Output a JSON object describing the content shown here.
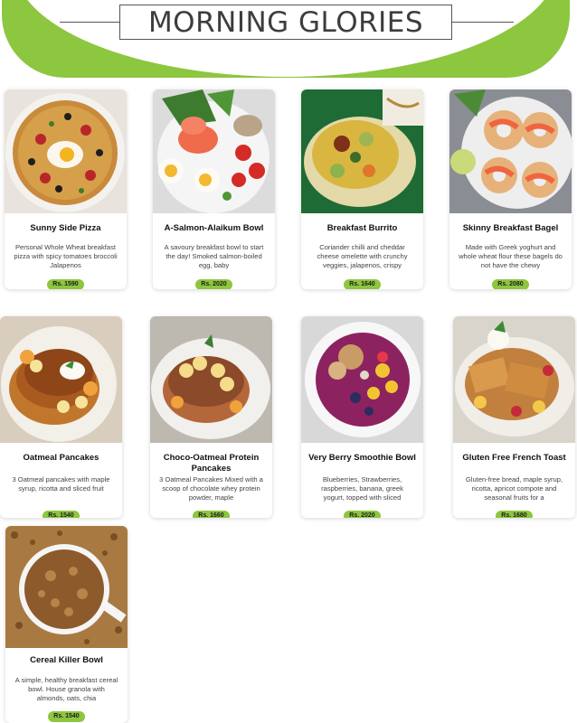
{
  "header": {
    "title": "MORNING GLORIES"
  },
  "colors": {
    "accent": "#8dc63f",
    "title": "#3d3d3d",
    "card_shadow": "#d9d9d9"
  },
  "items": [
    {
      "name": "Sunny Side Pizza",
      "description": "Personal Whole Wheat breakfast pizza with spicy tomatoes broccoli Jalapenos",
      "price": "Rs. 1590"
    },
    {
      "name": "A-Salmon-Alaikum Bowl",
      "description": "A savoury breakfast bowl to start the day! Smoked salmon-boiled egg, baby",
      "price": "Rs. 2020"
    },
    {
      "name": "Breakfast Burrito",
      "description": "Coriander chilli and cheddar cheese omelette with crunchy veggies, jalapenos, crispy",
      "price": "Rs. 1640"
    },
    {
      "name": "Skinny Breakfast Bagel",
      "description": "Made with Greek yoghurt and whole wheat flour these bagels do not have the chewy",
      "price": "Rs. 2080"
    },
    {
      "name": "Oatmeal Pancakes",
      "description": "3 Oatmeal pancakes with maple syrup, ricotta and sliced fruit",
      "price": "Rs. 1540"
    },
    {
      "name": "Choco-Oatmeal Protein Pancakes",
      "description": "3 Oatmeal Pancakes Mixed with a scoop of chocolate whey protein powder, maple",
      "price": "Rs. 1660"
    },
    {
      "name": "Very Berry Smoothie Bowl",
      "description": "Blueberries, Strawberries, raspberries, banana, greek yogurt, topped with sliced",
      "price": "Rs. 2020"
    },
    {
      "name": "Gluten Free French Toast",
      "description": "Gluten-free bread, maple syrup, ricotta, apricot compote and seasonal fruits for a",
      "price": "Rs. 1680"
    },
    {
      "name": "Cereal Killer Bowl",
      "description": "A simple, healthy breakfast cereal bowl. House granola with almonds, oats, chia",
      "price": "Rs. 1540"
    }
  ]
}
